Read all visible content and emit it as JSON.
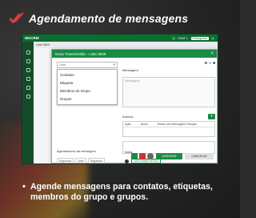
{
  "promo": {
    "title": "Agendamento de mensagens",
    "caption": "Agende mensagens para contatos, etiquetas, membros do grupo e grupos.",
    "brand_color": "#1a8a45",
    "accent_color": "#e23b3b"
  },
  "app": {
    "brand": "WACRM",
    "user_chip": "Portuguese",
    "topbar_label": "CHAT 1",
    "subheader": "Lista 3649"
  },
  "modal": {
    "title": "Nova Transmissão - Lista 3649",
    "close_icon": "close-icon",
    "select_placeholder": "Lista",
    "dropdown_options": [
      "Contatos",
      "Etiqueta",
      "Membros do Grupo",
      "Grupos"
    ],
    "message_label": "Mensagem",
    "message_placeholder": "Mensagem",
    "toolbar": {
      "bold": "B",
      "italic": "I",
      "strike": "S"
    },
    "attachments_label": "Anexos",
    "attach_add": "+",
    "attach_columns": [
      "Ação",
      "Nome",
      "Enviar com Mensagem Principal"
    ],
    "notes_label": "Notas",
    "notes_button": "ADICIONAR NOTAS",
    "schedule_label": "Agendamento da mensagem",
    "schedule_fields": [
      "Segundos",
      "0",
      "Jane",
      "Segundos",
      "0"
    ],
    "schedule_button": "AGENDAR",
    "cancel_button": "CANCELAR"
  }
}
